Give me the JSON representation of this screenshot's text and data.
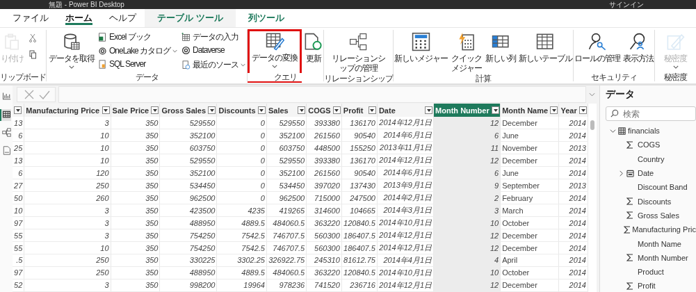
{
  "window": {
    "title": "無題 - Power BI Desktop",
    "account": "サインイン"
  },
  "tabs": [
    {
      "label": "ファイル",
      "selected": false,
      "contextual": false
    },
    {
      "label": "ホーム",
      "selected": true,
      "contextual": false
    },
    {
      "label": "ヘルプ",
      "selected": false,
      "contextual": false
    },
    {
      "label": "テーブル ツール",
      "selected": false,
      "contextual": true
    },
    {
      "label": "列ツール",
      "selected": false,
      "contextual": true
    }
  ],
  "ribbon": {
    "groups": [
      {
        "label": "リップボード",
        "buttons": [
          {
            "kind": "large",
            "label": "り付け",
            "disabled": true,
            "dropdown": false,
            "highlighted": false
          },
          {
            "kind": "icon"
          },
          {
            "kind": "icon"
          }
        ]
      },
      {
        "label": "データ",
        "buttons": [
          {
            "kind": "large",
            "label": "データを取得",
            "disabled": false,
            "dropdown": true,
            "highlighted": false
          },
          {
            "kind": "small",
            "label": "Excel ブック",
            "dropdown": false
          },
          {
            "kind": "small",
            "label": "OneLake カタログ",
            "dropdown": true
          },
          {
            "kind": "small",
            "label": "SQL Server",
            "dropdown": false
          },
          {
            "kind": "small",
            "label": "データの入力",
            "dropdown": false
          },
          {
            "kind": "small",
            "label": "Dataverse",
            "dropdown": false
          },
          {
            "kind": "small",
            "label": "最近のソース",
            "dropdown": true
          }
        ]
      },
      {
        "label": "クエリ",
        "buttons": [
          {
            "kind": "large",
            "label": "データの変換",
            "disabled": false,
            "dropdown": true,
            "highlighted": true
          },
          {
            "kind": "large",
            "label": "更新",
            "disabled": false,
            "dropdown": false,
            "highlighted": false
          }
        ]
      },
      {
        "label": "リレーションシップ",
        "buttons": [
          {
            "kind": "large",
            "label": "リレーションシップの管理",
            "disabled": false,
            "dropdown": false,
            "highlighted": false
          }
        ]
      },
      {
        "label": "計算",
        "buttons": [
          {
            "kind": "large",
            "label": "新しいメジャー",
            "disabled": false,
            "dropdown": false,
            "highlighted": false
          },
          {
            "kind": "large",
            "label": "クイックメジャー",
            "disabled": false,
            "dropdown": false,
            "highlighted": false
          },
          {
            "kind": "large",
            "label": "新しい列",
            "disabled": false,
            "dropdown": false,
            "highlighted": false
          },
          {
            "kind": "large",
            "label": "新しいテーブル",
            "disabled": false,
            "dropdown": false,
            "highlighted": false
          }
        ]
      },
      {
        "label": "セキュリティ",
        "buttons": [
          {
            "kind": "large",
            "label": "ロールの管理",
            "disabled": false,
            "dropdown": false,
            "highlighted": false
          },
          {
            "kind": "large",
            "label": "表示方法",
            "disabled": false,
            "dropdown": false,
            "highlighted": false
          }
        ]
      },
      {
        "label": "秘密度",
        "buttons": [
          {
            "kind": "large",
            "label": "秘密度",
            "disabled": true,
            "dropdown": true,
            "highlighted": false
          }
        ]
      }
    ]
  },
  "nav": [
    {
      "selected": false
    },
    {
      "selected": true
    },
    {
      "selected": false
    },
    {
      "selected": false
    }
  ],
  "table": {
    "columns": [
      {
        "kind": "number",
        "selected": false
      },
      {
        "label": "Manufacturing Price",
        "kind": "number",
        "selected": false
      },
      {
        "label": "Sale Price",
        "kind": "number",
        "selected": false
      },
      {
        "label": "Gross Sales",
        "kind": "number",
        "selected": false
      },
      {
        "label": "Discounts",
        "kind": "number",
        "selected": false
      },
      {
        "label": "Sales",
        "kind": "number",
        "selected": false
      },
      {
        "label": "COGS",
        "kind": "number",
        "selected": false
      },
      {
        "label": "Profit",
        "kind": "number",
        "selected": false
      },
      {
        "label": "Date",
        "kind": "date",
        "selected": false
      },
      {
        "label": "Month Number",
        "kind": "number",
        "selected": true
      },
      {
        "label": "Month Name",
        "kind": "text",
        "selected": false
      },
      {
        "label": "Year",
        "kind": "number",
        "selected": false
      }
    ],
    "rows": [
      [
        "13",
        "3",
        "350",
        "529550",
        "0",
        "529550",
        "393380",
        "136170",
        "2014年12月1日",
        "12",
        "December",
        "2014"
      ],
      [
        "6",
        "10",
        "350",
        "352100",
        "0",
        "352100",
        "261560",
        "90540",
        "2014年6月1日",
        "6",
        "June",
        "2014"
      ],
      [
        "25",
        "10",
        "350",
        "603750",
        "0",
        "603750",
        "448500",
        "155250",
        "2013年11月1日",
        "11",
        "November",
        "2013"
      ],
      [
        "13",
        "10",
        "350",
        "529550",
        "0",
        "529550",
        "393380",
        "136170",
        "2014年12月1日",
        "12",
        "December",
        "2014"
      ],
      [
        "6",
        "120",
        "350",
        "352100",
        "0",
        "352100",
        "261560",
        "90540",
        "2014年6月1日",
        "6",
        "June",
        "2014"
      ],
      [
        "27",
        "250",
        "350",
        "534450",
        "0",
        "534450",
        "397020",
        "137430",
        "2013年9月1日",
        "9",
        "September",
        "2013"
      ],
      [
        "50",
        "260",
        "350",
        "962500",
        "0",
        "962500",
        "715000",
        "247500",
        "2014年2月1日",
        "2",
        "February",
        "2014"
      ],
      [
        "10",
        "3",
        "350",
        "423500",
        "4235",
        "419265",
        "314600",
        "104665",
        "2014年3月1日",
        "3",
        "March",
        "2014"
      ],
      [
        "97",
        "3",
        "350",
        "488950",
        "4889.5",
        "484060.5",
        "363220",
        "120840.5",
        "2014年10月1日",
        "10",
        "October",
        "2014"
      ],
      [
        "55",
        "3",
        "350",
        "754250",
        "7542.5",
        "746707.5",
        "560300",
        "186407.5",
        "2014年12月1日",
        "12",
        "December",
        "2014"
      ],
      [
        "55",
        "10",
        "350",
        "754250",
        "7542.5",
        "746707.5",
        "560300",
        "186407.5",
        "2014年12月1日",
        "12",
        "December",
        "2014"
      ],
      [
        ".5",
        "250",
        "350",
        "330225",
        "3302.25",
        "326922.75",
        "245310",
        "81612.75",
        "2014年4月1日",
        "4",
        "April",
        "2014"
      ],
      [
        "97",
        "250",
        "350",
        "488950",
        "4889.5",
        "484060.5",
        "363220",
        "120840.5",
        "2014年10月1日",
        "10",
        "October",
        "2014"
      ],
      [
        "52",
        "3",
        "350",
        "998200",
        "19964",
        "978236",
        "741520",
        "236716",
        "2014年12月1日",
        "12",
        "December",
        "2014"
      ]
    ]
  },
  "data_pane": {
    "title": "データ",
    "search": {
      "placeholder": "検索"
    },
    "tree": [
      {
        "label": "financials",
        "kind": "table",
        "expanded": true,
        "children": [
          {
            "label": "COGS",
            "kind": "measure"
          },
          {
            "label": "Country",
            "kind": "text"
          },
          {
            "label": "Date",
            "kind": "date",
            "expanded": false
          },
          {
            "label": "Discount Band",
            "kind": "text"
          },
          {
            "label": "Discounts",
            "kind": "measure"
          },
          {
            "label": "Gross Sales",
            "kind": "measure"
          },
          {
            "label": "Manufacturing Pric",
            "kind": "measure"
          },
          {
            "label": "Month Name",
            "kind": "text"
          },
          {
            "label": "Month Number",
            "kind": "measure"
          },
          {
            "label": "Product",
            "kind": "text"
          },
          {
            "label": "Profit",
            "kind": "measure"
          }
        ]
      }
    ]
  }
}
